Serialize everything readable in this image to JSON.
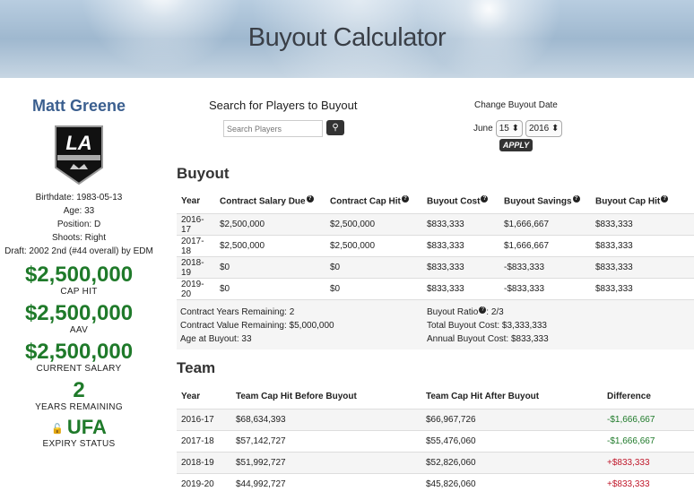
{
  "header": {
    "title": "Buyout Calculator"
  },
  "player": {
    "name": "Matt Greene",
    "logo_text": "LA",
    "birthdate": "Birthdate: 1983-05-13",
    "age": "Age: 33",
    "position": "Position: D",
    "shoots": "Shoots: Right",
    "draft": "Draft: 2002 2nd (#44 overall) by EDM",
    "cap_hit": "$2,500,000",
    "cap_hit_label": "CAP HIT",
    "aav": "$2,500,000",
    "aav_label": "AAV",
    "current_salary": "$2,500,000",
    "current_salary_label": "CURRENT SALARY",
    "years_remaining": "2",
    "years_remaining_label": "YEARS REMAINING",
    "expiry": "UFA",
    "expiry_label": "EXPIRY STATUS"
  },
  "search": {
    "title": "Search for Players to Buyout",
    "placeholder": "Search Players",
    "icon": "search-icon"
  },
  "buyout_date": {
    "title": "Change Buyout Date",
    "month": "June",
    "day": "15",
    "year": "2016",
    "apply": "APPLY"
  },
  "buyout": {
    "heading": "Buyout",
    "columns": [
      "Year",
      "Contract Salary Due",
      "Contract Cap Hit",
      "Buyout Cost",
      "Buyout Savings",
      "Buyout Cap Hit"
    ],
    "rows": [
      [
        "2016-17",
        "$2,500,000",
        "$2,500,000",
        "$833,333",
        "$1,666,667",
        "$833,333"
      ],
      [
        "2017-18",
        "$2,500,000",
        "$2,500,000",
        "$833,333",
        "$1,666,667",
        "$833,333"
      ],
      [
        "2018-19",
        "$0",
        "$0",
        "$833,333",
        "-$833,333",
        "$833,333"
      ],
      [
        "2019-20",
        "$0",
        "$0",
        "$833,333",
        "-$833,333",
        "$833,333"
      ]
    ],
    "summary": {
      "contract_years": "Contract Years Remaining: 2",
      "contract_value": "Contract Value Remaining: $5,000,000",
      "age_at_buyout": "Age at Buyout: 33",
      "ratio_label": "Buyout Ratio",
      "ratio_value": ": 2/3",
      "total_cost": "Total Buyout Cost: $3,333,333",
      "annual_cost": "Annual Buyout Cost: $833,333"
    }
  },
  "team": {
    "heading": "Team",
    "columns": [
      "Year",
      "Team Cap Hit Before Buyout",
      "Team Cap Hit After Buyout",
      "Difference"
    ],
    "rows": [
      [
        "2016-17",
        "$68,634,393",
        "$66,967,726",
        "-$1,666,667"
      ],
      [
        "2017-18",
        "$57,142,727",
        "$55,476,060",
        "-$1,666,667"
      ],
      [
        "2018-19",
        "$51,992,727",
        "$52,826,060",
        "+$833,333"
      ],
      [
        "2019-20",
        "$44,992,727",
        "$45,826,060",
        "+$833,333"
      ]
    ]
  },
  "colors": {
    "accent": "#1f7a2a",
    "negative": "#c0182b",
    "name": "#3b5f8f"
  }
}
